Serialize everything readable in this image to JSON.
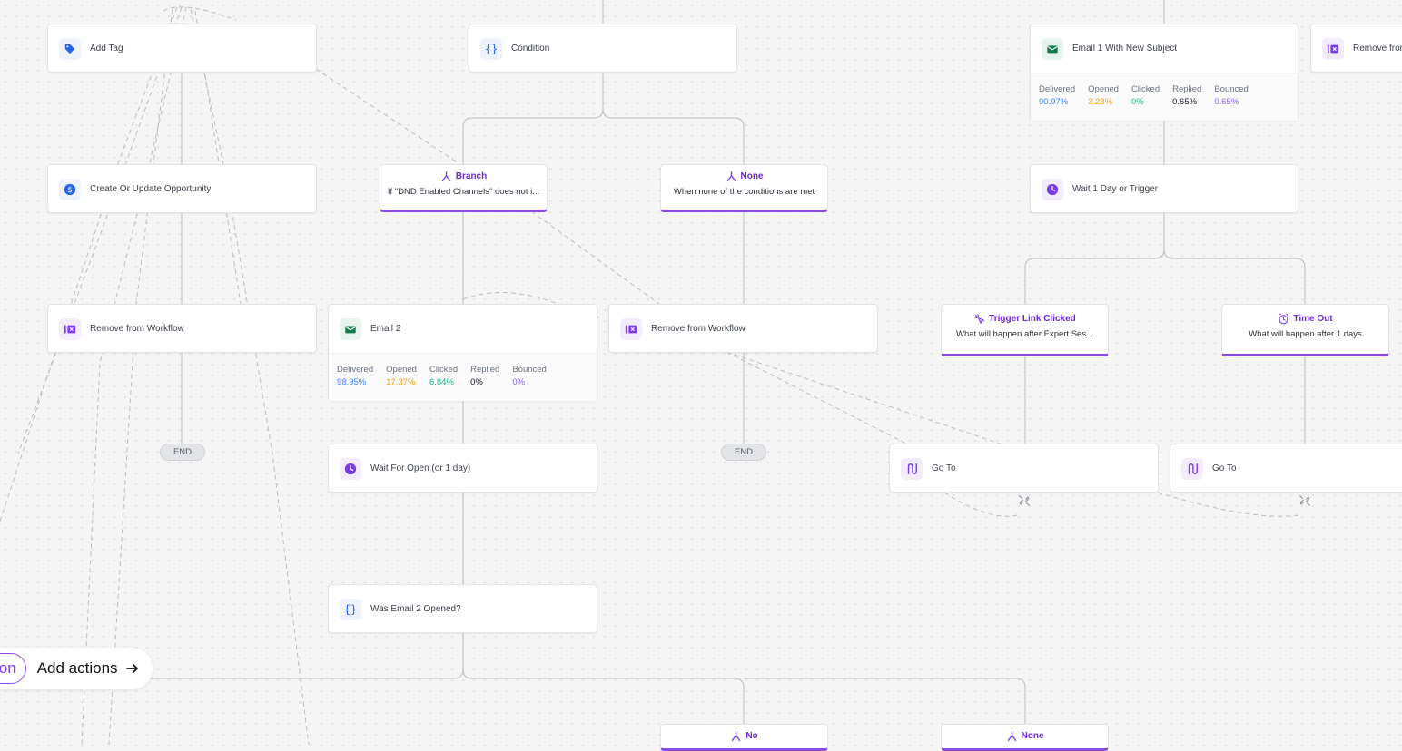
{
  "actions": {
    "add_tag": "Add Tag",
    "condition": "Condition",
    "email1": "Email 1 With New Subject",
    "remove_from_right": "Remove from",
    "create_opportunity": "Create Or Update Opportunity",
    "wait_1_day": "Wait 1 Day or Trigger",
    "remove_workflow_left": "Remove from Workflow",
    "email2": "Email 2",
    "remove_workflow_mid": "Remove from Workflow",
    "wait_open": "Wait For Open (or 1 day)",
    "was_opened": "Was Email 2 Opened?",
    "goto_1": "Go To",
    "goto_2": "Go To"
  },
  "email1_stats": [
    {
      "key": "Delivered",
      "value": "90.97%",
      "color": "#3b82f6"
    },
    {
      "key": "Opened",
      "value": "3.23%",
      "color": "#f59e0b"
    },
    {
      "key": "Clicked",
      "value": "0%",
      "color": "#10b981"
    },
    {
      "key": "Replied",
      "value": "0.65%",
      "color": "#111827"
    },
    {
      "key": "Bounced",
      "value": "0.65%",
      "color": "#8b5cf6"
    }
  ],
  "email2_stats": [
    {
      "key": "Delivered",
      "value": "98.95%",
      "color": "#3b82f6"
    },
    {
      "key": "Opened",
      "value": "17.37%",
      "color": "#f59e0b"
    },
    {
      "key": "Clicked",
      "value": "6.84%",
      "color": "#10b981"
    },
    {
      "key": "Replied",
      "value": "0%",
      "color": "#111827"
    },
    {
      "key": "Bounced",
      "value": "0%",
      "color": "#8b5cf6"
    }
  ],
  "branches": {
    "branch": {
      "title": "Branch",
      "sub": "If \"DND Enabled Channels\" does not i..."
    },
    "none_top": {
      "title": "None",
      "sub": "When none of the conditions are met"
    },
    "trigger_link": {
      "title": "Trigger Link Clicked",
      "sub": "What will happen after Expert Ses..."
    },
    "timeout": {
      "title": "Time Out",
      "sub": "What will happen after 1 days"
    },
    "no": {
      "title": "No"
    },
    "none_bottom": {
      "title": "None"
    }
  },
  "end_labels": {
    "left": "END",
    "mid": "END"
  },
  "add_actions": {
    "pill": "ion",
    "label": "Add actions"
  },
  "icons": {
    "tag": "tag-icon",
    "condition": "braces-icon",
    "email": "envelope-icon",
    "remove": "remove-workflow-icon",
    "opportunity": "dollar-icon",
    "clock": "clock-icon",
    "goto": "goto-icon",
    "unlink": "unlink-icon",
    "branch": "branch-icon",
    "trigger": "sparkle-icon",
    "timeout": "alarm-icon",
    "arrow": "arrow-right-icon"
  },
  "colors": {
    "accent": "#7c3aed",
    "branch_border": "#8a4ce0",
    "tag_blue": "#2563eb",
    "email_green": "#0f7a4a"
  }
}
